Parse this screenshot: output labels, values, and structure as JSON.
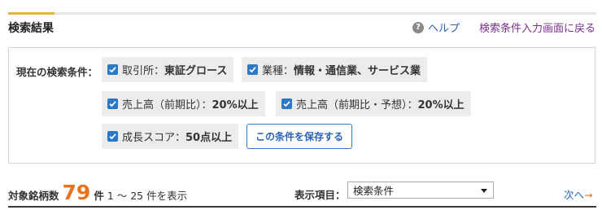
{
  "header": {
    "title": "検索結果",
    "help_icon_glyph": "?",
    "help_label": "ヘルプ",
    "back_link": "検索条件入力画面に戻る"
  },
  "conditions": {
    "label": "現在の検索条件：",
    "items": [
      {
        "name": "取引所：",
        "value": "東証グロース",
        "checked": true
      },
      {
        "name": "業種：",
        "value": "情報・通信業、サービス業",
        "checked": true
      },
      {
        "name": "売上高（前期比）：",
        "value": "20%以上",
        "checked": true
      },
      {
        "name": "売上高（前期比・予想）：",
        "value": "20%以上",
        "checked": true
      },
      {
        "name": "成長スコア：",
        "value": "50点以上",
        "checked": true
      }
    ],
    "save_button": "この条件を保存する"
  },
  "results": {
    "label": "対象銘柄数",
    "count": "79",
    "unit": "件",
    "range": "1 ～ 25 件を表示"
  },
  "display": {
    "label": "表示項目：",
    "selected": "検索条件"
  },
  "pagination": {
    "next_label": "次へ",
    "next_arrow": "→"
  },
  "colors": {
    "accent_bar": "#e8b131",
    "checkbox": "#2a78c8",
    "count": "#e8731e",
    "link": "#2a63b8",
    "back_link": "#7a2e8f"
  }
}
